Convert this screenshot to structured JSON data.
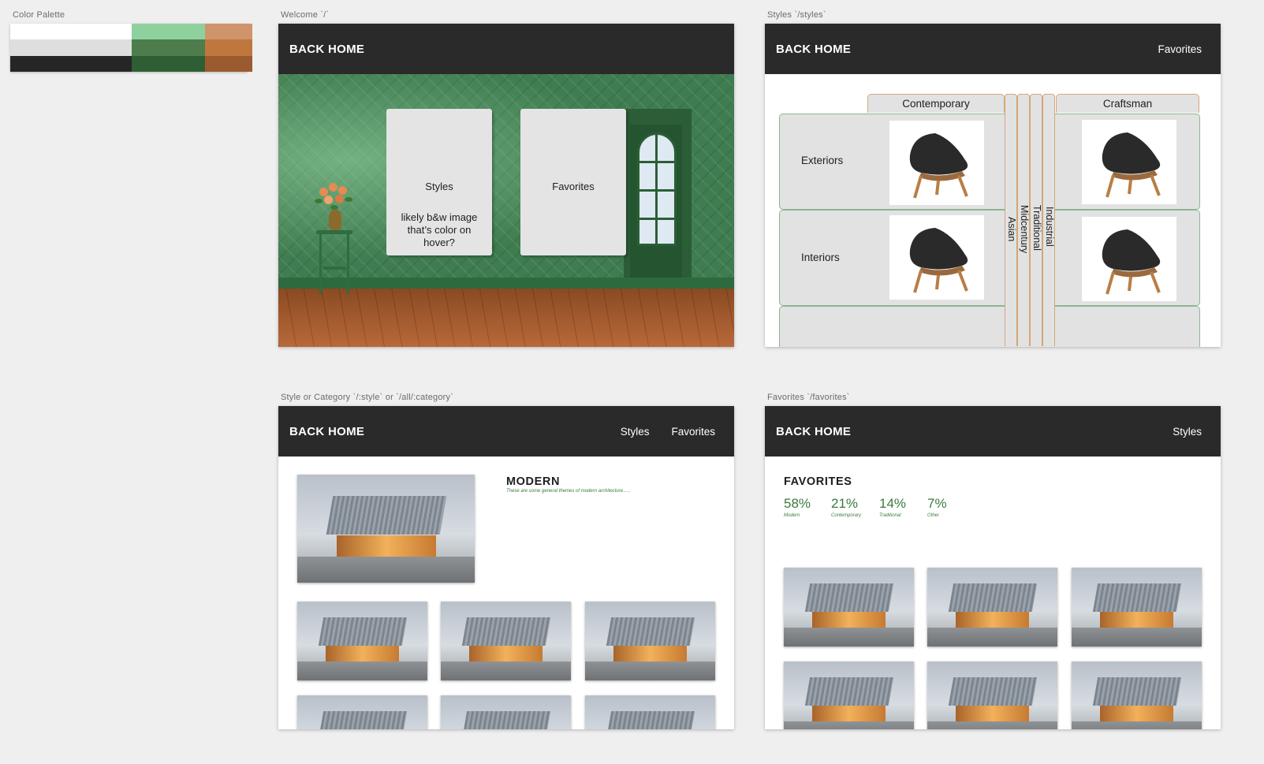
{
  "labels": {
    "palette": "Color Palette",
    "welcome": "Welcome `/`",
    "styles": "Styles `/styles`",
    "style_category": "Style or Category `/:style` or `/all/:category`",
    "favorites": "Favorites `/favorites`"
  },
  "palette": {
    "colors": [
      "#ffffff",
      "#8fd19e",
      "#cf946b",
      "#dedede",
      "#4d7d4c",
      "#c0773d",
      "#262626",
      "#2e5f34",
      "#9b5b2f"
    ]
  },
  "welcome": {
    "brand": "BACK HOME",
    "styles_card": {
      "title": "Styles",
      "note": "likely b&w image that’s color on hover?"
    },
    "favorites_card": {
      "title": "Favorites"
    }
  },
  "styles_page": {
    "brand": "BACK HOME",
    "nav": [
      "Favorites"
    ],
    "columns": {
      "left": "Contemporary",
      "right": "Craftsman",
      "collapsed": [
        "Asian",
        "Midcentury",
        "Traditional",
        "Industrial"
      ]
    },
    "rows": [
      "Exteriors",
      "Interiors"
    ]
  },
  "style_page": {
    "brand": "BACK HOME",
    "nav": [
      "Styles",
      "Favorites"
    ],
    "title": "MODERN",
    "subtitle": "These are some general themes of modern architecture….."
  },
  "favorites_page": {
    "brand": "BACK HOME",
    "nav": [
      "Styles"
    ],
    "title": "FAVORITES",
    "stats": [
      {
        "percent": "58%",
        "name": "Modern",
        "value": 58
      },
      {
        "percent": "21%",
        "name": "Contemporary",
        "value": 21
      },
      {
        "percent": "14%",
        "name": "Traditional",
        "value": 14
      },
      {
        "percent": "7%",
        "name": "Other",
        "value": 7
      }
    ]
  }
}
